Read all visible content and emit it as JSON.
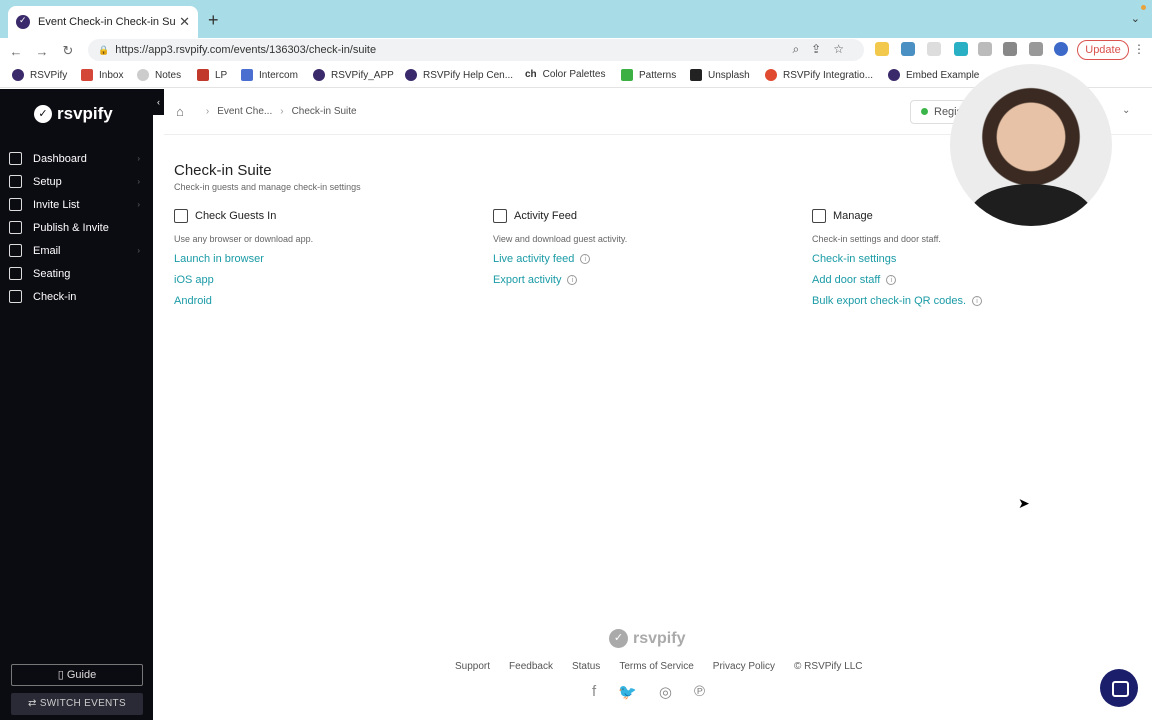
{
  "browser": {
    "tab_title": "Event Check-in Check-in Suite",
    "url": "https://app3.rsvpify.com/events/136303/check-in/suite",
    "update_label": "Update",
    "bookmarks": [
      "RSVPify",
      "Inbox",
      "Notes",
      "LP",
      "Intercom",
      "RSVPify_APP",
      "RSVPify Help Cen...",
      "Color Palettes",
      "Patterns",
      "Unsplash",
      "RSVPify Integratio...",
      "Embed Example"
    ],
    "bookmark_prefix_ch": "ch"
  },
  "sidebar": {
    "brand": "rsvpify",
    "items": [
      "Dashboard",
      "Setup",
      "Invite List",
      "Publish & Invite",
      "Email",
      "Seating",
      "Check-in"
    ],
    "guide_label": "Guide",
    "switch_label": "SWITCH EVENTS"
  },
  "breadcrumb": {
    "items": [
      "Event Che...",
      "Check-in Suite"
    ]
  },
  "status": {
    "label": "Regis"
  },
  "page": {
    "title": "Check-in Suite",
    "subtitle": "Check-in guests and manage check-in settings"
  },
  "sections": [
    {
      "title": "Check Guests In",
      "desc": "Use any browser or download app.",
      "links": [
        "Launch in browser",
        "iOS app",
        "Android"
      ]
    },
    {
      "title": "Activity Feed",
      "desc": "View and download guest activity.",
      "links": [
        "Live activity feed",
        "Export activity"
      ]
    },
    {
      "title": "Manage",
      "desc": "Check-in settings and door staff.",
      "links": [
        "Check-in settings",
        "Add door staff",
        "Bulk export check-in QR codes."
      ]
    }
  ],
  "footer": {
    "brand": "rsvpify",
    "links": [
      "Support",
      "Feedback",
      "Status",
      "Terms of Service",
      "Privacy Policy",
      "© RSVPify LLC"
    ]
  },
  "colors": {
    "accent": "#1a9ba6",
    "sidebar_bg": "#0b0b12",
    "chrome_bg": "#a8dce6"
  }
}
